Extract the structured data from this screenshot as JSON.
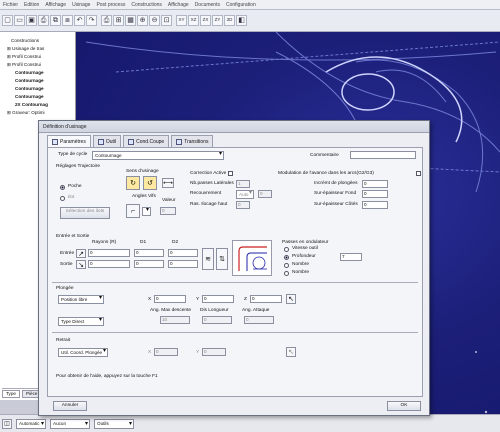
{
  "menubar": {
    "items": [
      "Fichier",
      "Edition",
      "Affichage",
      "Usinage",
      "Post process",
      "Constructions",
      "Affichage",
      "Documents",
      "Configuration"
    ]
  },
  "toolbar": {
    "icons": [
      "new-icon",
      "open-icon",
      "save-icon",
      "print-icon",
      "copy-icon",
      "paste-icon",
      "undo-icon",
      "redo-icon",
      "print2-icon",
      "zoom-icon",
      "grid-icon",
      "zoom-in-icon",
      "zoom-out-icon",
      "zoom-window-icon",
      "view-xy-icon",
      "view-xz-icon",
      "view-zx-icon",
      "view-zy-icon",
      "view-iso-icon",
      "render-icon"
    ],
    "glyphs": [
      "▢",
      "▭",
      "▣",
      "⎙",
      "⧉",
      "⧈",
      "↶",
      "↷",
      "⎙",
      "⊞",
      "▦",
      "⊕",
      "⊖",
      "⊡",
      "XY",
      "XZ",
      "ZX",
      "ZY",
      "3D",
      "◧"
    ]
  },
  "tree": {
    "items": [
      {
        "label": "Constructions",
        "indent": 2
      },
      {
        "label": "Usinage de tras",
        "indent": 1
      },
      {
        "label": "Profil Construi",
        "indent": 1
      },
      {
        "label": "Profil Construi",
        "indent": 1
      },
      {
        "label": "Contournage",
        "indent": 3
      },
      {
        "label": "Contournage",
        "indent": 3
      },
      {
        "label": "Contournage",
        "indent": 3
      },
      {
        "label": "Contournage",
        "indent": 3
      },
      {
        "label": "2X Contournag",
        "indent": 3
      },
      {
        "label": "Graveur: Optimi",
        "indent": 1
      }
    ],
    "bottom_tabs": [
      "Type",
      "Pièce"
    ]
  },
  "dialog": {
    "title": "Définition d'usinage",
    "tabs": [
      "Paramètres",
      "Outil",
      "Cond.Coupe",
      "Transitions"
    ],
    "type_cycle_label": "Type de cycle",
    "type_cycle_value": "Contournage",
    "commentaire_label": "Commentaire",
    "commentaire_value": "",
    "reglages_label": "Réglages Trajectoire",
    "sens_usinage_label": "Sens d'usinage",
    "poche_label": "Poche",
    "ilot_label": "Ilot",
    "selection_label": "Sélection des ilots",
    "angles_label": "Angles Vifs",
    "valeur_label": "Valeur",
    "valeur_value": "0",
    "correction_label": "Correction Active",
    "nb_passes_label": "Nb.passes Latérales",
    "nb_passes_value": "1",
    "recouvrement_label": "Recouvrement",
    "recouvrement_value": "Auto",
    "recouvrement_num": "0",
    "ras_label": "Ras. Ilocage haut",
    "ras_value": "0",
    "modulation_label": "Modulation de l'avance dans les arcs(G2/G3)",
    "incr_label": "Incrémt de plongées",
    "incr_value": "0",
    "sur_fond_label": "Sur-épaisseur Fond",
    "sur_fond_value": "0",
    "sur_cote_label": "Sur-épaisseur Côtés",
    "sur_cote_value": "0",
    "entree_sortie_label": "Entrée et Sortie",
    "rayon_label": "Rayons (R)",
    "d1_label": "D1",
    "d2_label": "D2",
    "entree_label": "Entrée",
    "sortie_label": "Sortie",
    "entree_vals": [
      "0",
      "0",
      "0"
    ],
    "sortie_vals": [
      "0",
      "0",
      "0"
    ],
    "passes_label": "Passes en ondulateur",
    "pass_options": [
      "Vitesse outil",
      "Profondeur",
      "Nombre",
      "Nombre"
    ],
    "pass_value": "7",
    "plongee_label": "Plongée",
    "plongee_mode": "Position libre",
    "plongee_type": "Type Direct",
    "x_label": "X",
    "y_label": "Y",
    "z_label": "Z",
    "x_value": "0",
    "y_value": "0",
    "z_value": "0",
    "ang_max_label": "Ang. Max descente",
    "dist_label": "Dis Longueur",
    "ang_att_label": "Ang. Attaque",
    "ang_max_value": "10",
    "dist_value": "0",
    "ang_att_value": "0",
    "retrait_label": "Retrait",
    "retrait_mode": "Util. Coord. Plongée",
    "retrait_x": "0",
    "retrait_y": "0",
    "hint": "Pour obtenir de l'aide, appuyez sur la touche F1",
    "annuler_label": "Annuler",
    "ok_label": "OK"
  },
  "statusbar": {
    "mode": "Automatic",
    "combo2": "Aucun",
    "combo3": "Outils"
  }
}
